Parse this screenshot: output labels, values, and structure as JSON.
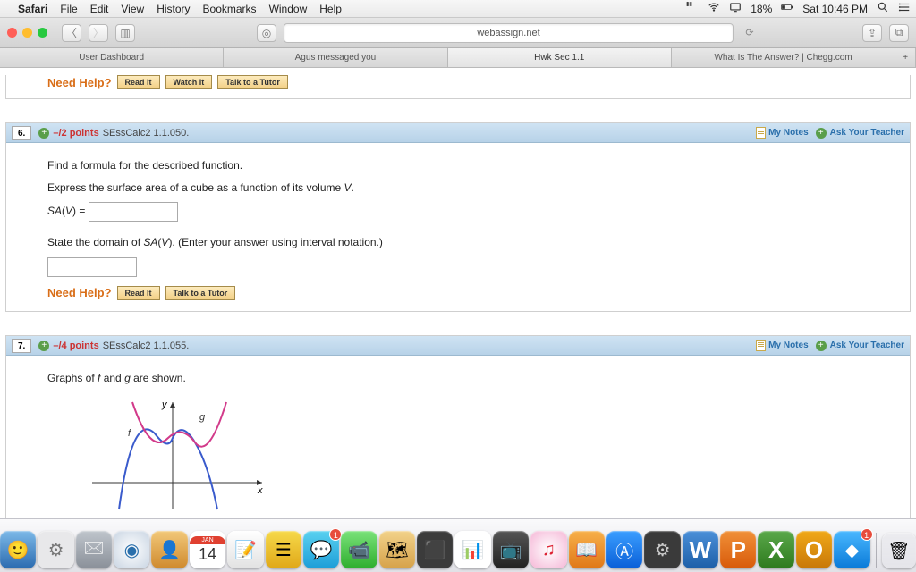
{
  "menubar": {
    "app": "Safari",
    "items": [
      "File",
      "Edit",
      "View",
      "History",
      "Bookmarks",
      "Window",
      "Help"
    ],
    "battery": "18%",
    "clock": "Sat 10:46 PM"
  },
  "browser": {
    "url": "webassign.net",
    "tabs": [
      "User Dashboard",
      "Agus messaged you",
      "Hwk Sec 1.1",
      "What Is The Answer? | Chegg.com"
    ],
    "active_tab": 2
  },
  "help": {
    "label": "Need Help?",
    "read": "Read It",
    "watch": "Watch It",
    "tutor": "Talk to a Tutor"
  },
  "header_links": {
    "notes": "My Notes",
    "ask": "Ask Your Teacher"
  },
  "q6": {
    "num": "6.",
    "points": "–/2 points",
    "ref": "SEssCalc2 1.1.050.",
    "line1": "Find a formula for the described function.",
    "line2_a": "Express the surface area of a cube as a function of its volume ",
    "line2_v": "V",
    "line2_b": ".",
    "sa_label_a": "SA",
    "sa_label_b": "(",
    "sa_label_c": "V",
    "sa_label_d": ") =",
    "line3_a": "State the domain of ",
    "line3_b": "SA",
    "line3_c": "(",
    "line3_d": "V",
    "line3_e": "). (Enter your answer using interval notation.)"
  },
  "q7": {
    "num": "7.",
    "points": "–/4 points",
    "ref": "SEssCalc2 1.1.055.",
    "line1_a": "Graphs of ",
    "line1_b": "f",
    "line1_c": " and ",
    "line1_d": "g",
    "line1_e": " are shown.",
    "axis_x": "x",
    "axis_y": "y",
    "label_f": "f",
    "label_g": "g"
  },
  "dock": {
    "cal_month": "JAN",
    "cal_day": "14"
  }
}
